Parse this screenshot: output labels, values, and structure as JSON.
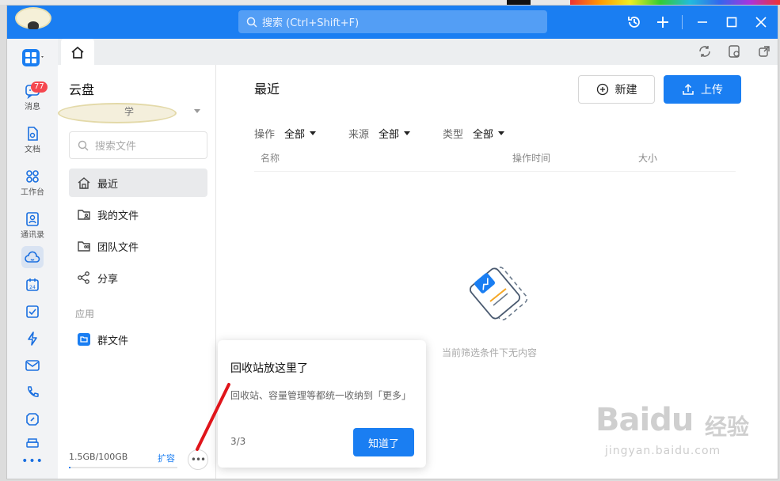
{
  "search": {
    "placeholder": "搜索 (Ctrl+Shift+F)"
  },
  "rail": {
    "badge": "77",
    "items": [
      {
        "label": "消息"
      },
      {
        "label": "文档"
      },
      {
        "label": "工作台"
      },
      {
        "label": "通讯录"
      }
    ]
  },
  "sidebar": {
    "title": "云盘",
    "org_suffix": "学",
    "search_placeholder": "搜索文件",
    "nav": [
      {
        "label": "最近"
      },
      {
        "label": "我的文件"
      },
      {
        "label": "团队文件"
      },
      {
        "label": "分享"
      }
    ],
    "apps_label": "应用",
    "apps": [
      {
        "label": "群文件"
      }
    ],
    "storage": "1.5GB/100GB",
    "storage_fraction": 0.015,
    "expand": "扩容"
  },
  "main": {
    "title": "最近",
    "new_button": "新建",
    "upload_button": "上传",
    "filters": [
      {
        "key": "操作",
        "value": "全部"
      },
      {
        "key": "来源",
        "value": "全部"
      },
      {
        "key": "类型",
        "value": "全部"
      }
    ],
    "columns": [
      "名称",
      "操作时间",
      "大小"
    ],
    "empty_text": "当前筛选条件下无内容"
  },
  "popover": {
    "title": "回收站放这里了",
    "body": "回收站、容量管理等都统一收纳到「更多」",
    "page": "3/3",
    "button": "知道了"
  },
  "watermark": {
    "brand": "Baidu",
    "brand_cn": "经验",
    "url": "jingyan.baidu.com"
  },
  "colors": {
    "accent": "#1a7ef2",
    "badge": "#f5474f"
  }
}
